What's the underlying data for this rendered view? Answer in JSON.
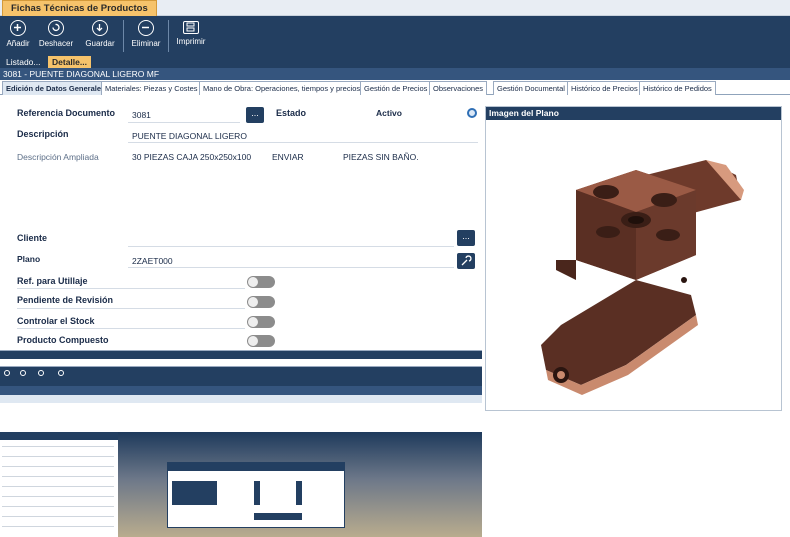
{
  "window": {
    "title": "Fichas Técnicas de Productos"
  },
  "toolbar": {
    "buttons": [
      {
        "label": "Añadir",
        "icon": "plus-icon"
      },
      {
        "label": "Deshacer",
        "icon": "undo-icon"
      },
      {
        "label": "Guardar",
        "icon": "save-icon"
      },
      {
        "label": "Eliminar",
        "icon": "minus-icon"
      },
      {
        "label": "Imprimir",
        "icon": "printer-icon"
      }
    ]
  },
  "subtabs": {
    "list": "Listado...",
    "detail": "Detalle..."
  },
  "record": {
    "title": "3081 - PUENTE DIAGONAL LIGERO MF"
  },
  "tabs": [
    "Edición de Datos Generales",
    "Materiales: Piezas y Costes",
    "Mano de Obra: Operaciones, tiempos y precios",
    "Gestión de Precios",
    "Observaciones",
    "Gestión Documental",
    "Histórico de Precios",
    "Histórico de Pedidos"
  ],
  "form": {
    "ref_label": "Referencia Documento",
    "ref_value": "3081",
    "ref_button": "...",
    "estado_label": "Estado",
    "estado_value": "Activo",
    "desc_label": "Descripción",
    "desc_value": "PUENTE DIAGONAL LIGERO",
    "desc_amp_label": "Descripción Ampliada",
    "desc_amp_value1": "30 PIEZAS CAJA 250x250x100",
    "desc_amp_value2": "ENVIAR",
    "desc_amp_value3": "PIEZAS SIN BAÑO.",
    "cliente_label": "Cliente",
    "cliente_button": "...",
    "plano_label": "Plano",
    "plano_value": "2ZAET000",
    "toggles": [
      {
        "label": "Ref. para Utillaje",
        "on": false
      },
      {
        "label": "Pendiente de Revisión",
        "on": false
      },
      {
        "label": "Controlar el Stock",
        "on": false
      },
      {
        "label": "Producto Compuesto",
        "on": false
      }
    ]
  },
  "image_panel": {
    "title": "Imagen del Plano"
  },
  "colors": {
    "navy": "#233f61",
    "accent": "#f6c36b",
    "part": "#6b3a2c"
  }
}
